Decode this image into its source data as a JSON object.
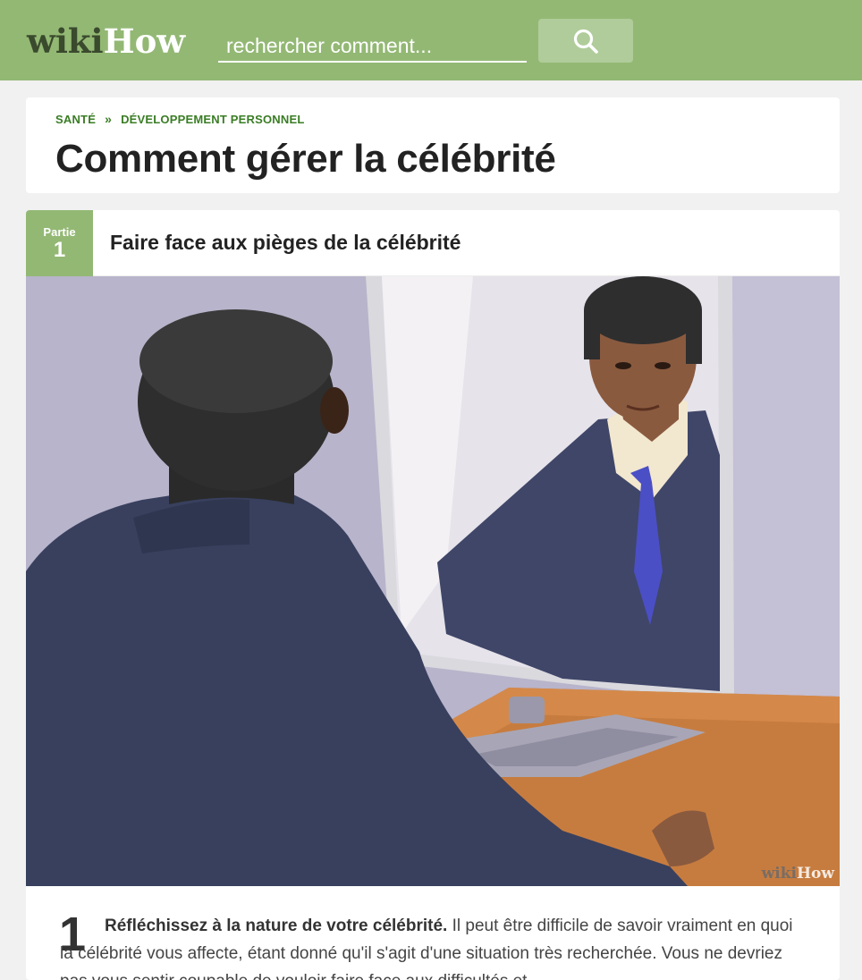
{
  "header": {
    "logo_wiki": "wiki",
    "logo_how": "How",
    "search_placeholder": "rechercher comment...",
    "search_icon": "search-icon",
    "bg_color": "#93b874"
  },
  "breadcrumb": {
    "items": [
      "SANTÉ",
      "DÉVELOPPEMENT PERSONNEL"
    ],
    "separator": "»"
  },
  "page": {
    "title": "Comment gérer la célébrité"
  },
  "part": {
    "label": "Partie",
    "number": "1",
    "title": "Faire face aux pièges de la célébrité",
    "image_watermark_wiki": "wiki",
    "image_watermark_how": "How"
  },
  "step": {
    "number": "1",
    "bold": "Réfléchissez à la nature de votre célébrité.",
    "text": " Il peut être difficile de savoir vraiment en quoi la célébrité vous affecte, étant donné qu'il s'agit d'une situation très recherchée. Vous ne devriez pas vous sentir coupable de vouloir faire face aux difficultés et"
  }
}
